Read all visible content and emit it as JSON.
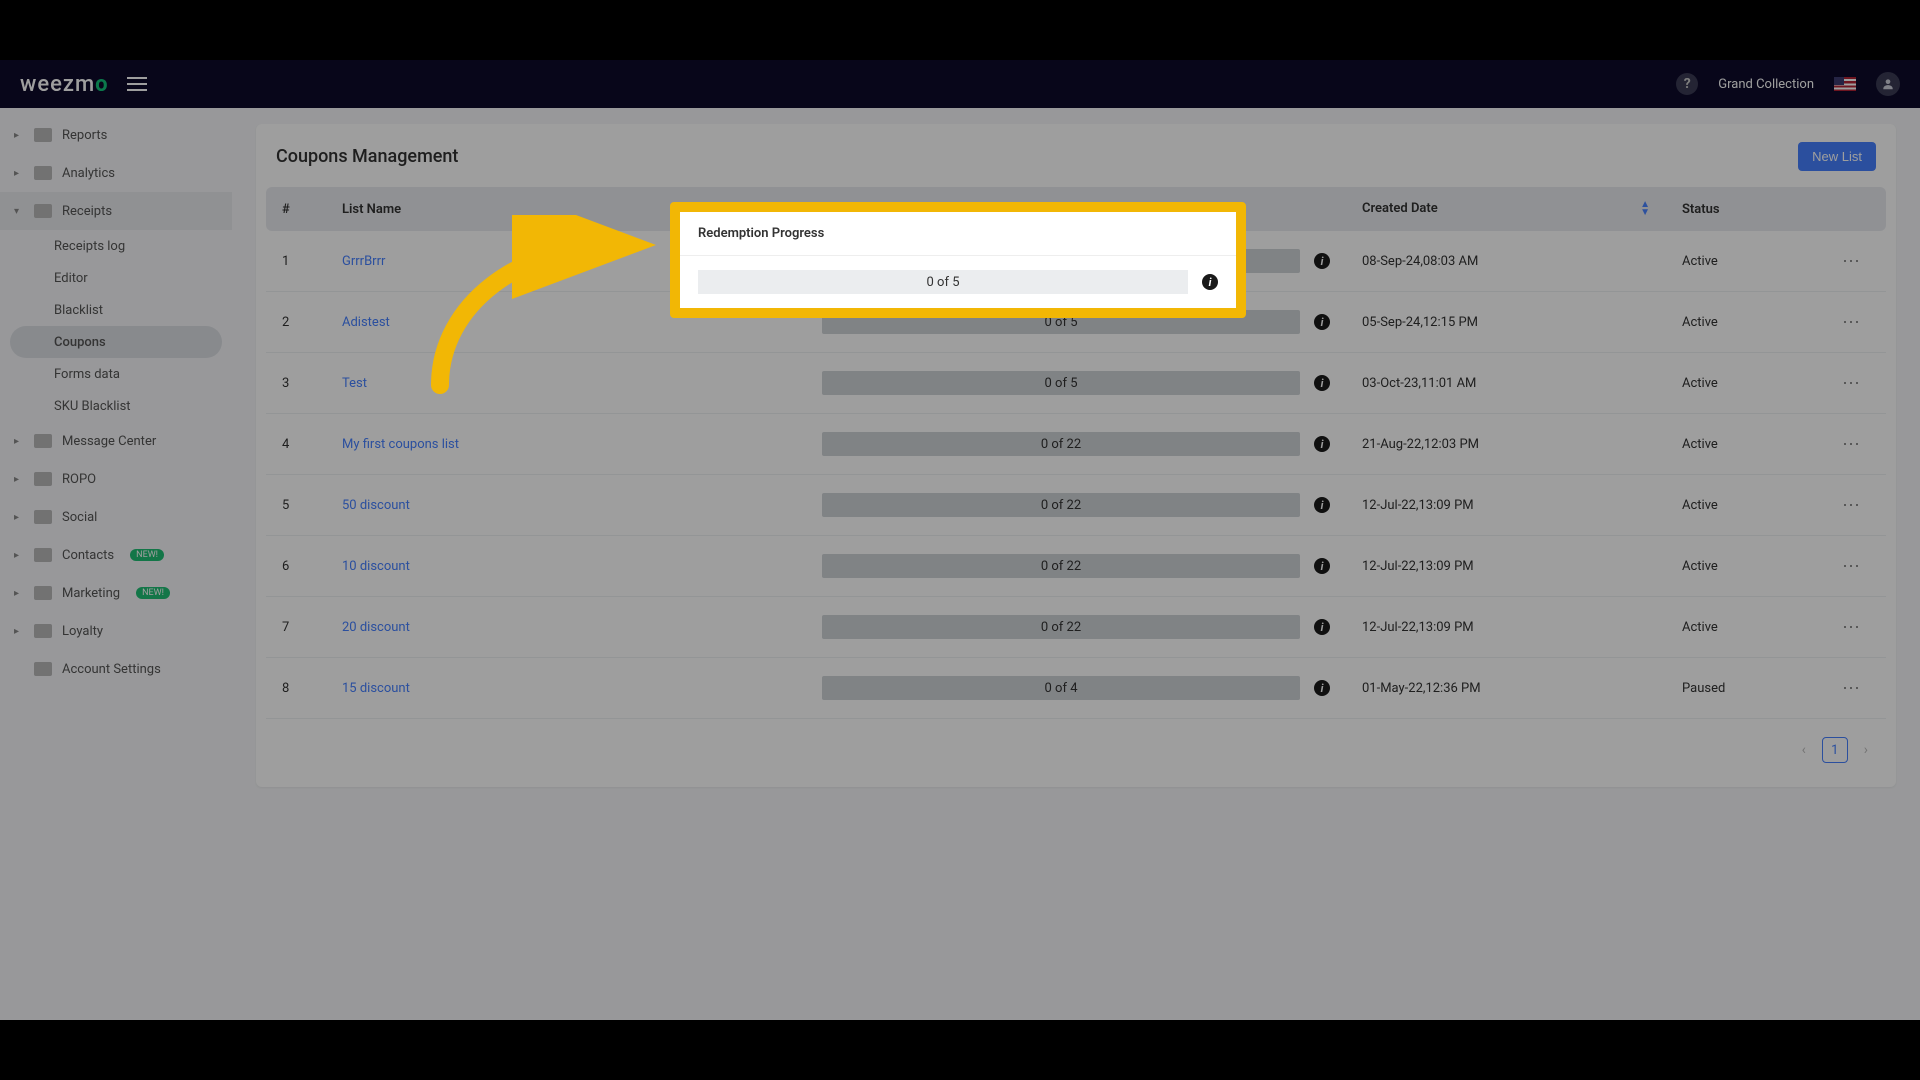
{
  "topbar": {
    "logo_main": "weezm",
    "logo_accent": "o",
    "account_name": "Grand Collection"
  },
  "sidebar": {
    "items": [
      {
        "label": "Reports"
      },
      {
        "label": "Analytics"
      },
      {
        "label": "Receipts",
        "expanded": true,
        "children": [
          {
            "label": "Receipts log"
          },
          {
            "label": "Editor"
          },
          {
            "label": "Blacklist"
          },
          {
            "label": "Coupons",
            "active": true
          },
          {
            "label": "Forms data"
          },
          {
            "label": "SKU Blacklist"
          }
        ]
      },
      {
        "label": "Message Center"
      },
      {
        "label": "ROPO"
      },
      {
        "label": "Social"
      },
      {
        "label": "Contacts",
        "badge": "NEW!"
      },
      {
        "label": "Marketing",
        "badge": "NEW!"
      },
      {
        "label": "Loyalty"
      },
      {
        "label": "Account Settings"
      }
    ]
  },
  "page": {
    "title": "Coupons Management",
    "new_list_label": "New List"
  },
  "table": {
    "columns": {
      "num": "#",
      "name": "List Name",
      "progress": "Redemption Progress",
      "date": "Created Date",
      "status": "Status"
    },
    "rows": [
      {
        "num": "1",
        "name": "GrrrBrrr",
        "progress": "0 of 5",
        "date": "08-Sep-24,08:03 AM",
        "status": "Active"
      },
      {
        "num": "2",
        "name": "Adistest",
        "progress": "0 of 5",
        "date": "05-Sep-24,12:15 PM",
        "status": "Active"
      },
      {
        "num": "3",
        "name": "Test",
        "progress": "0 of 5",
        "date": "03-Oct-23,11:01 AM",
        "status": "Active"
      },
      {
        "num": "4",
        "name": "My first coupons list",
        "progress": "0 of 22",
        "date": "21-Aug-22,12:03 PM",
        "status": "Active"
      },
      {
        "num": "5",
        "name": "50 discount",
        "progress": "0 of 22",
        "date": "12-Jul-22,13:09 PM",
        "status": "Active"
      },
      {
        "num": "6",
        "name": "10 discount",
        "progress": "0 of 22",
        "date": "12-Jul-22,13:09 PM",
        "status": "Active"
      },
      {
        "num": "7",
        "name": "20 discount",
        "progress": "0 of 22",
        "date": "12-Jul-22,13:09 PM",
        "status": "Active"
      },
      {
        "num": "8",
        "name": "15 discount",
        "progress": "0 of 4",
        "date": "01-May-22,12:36 PM",
        "status": "Paused"
      }
    ]
  },
  "pagination": {
    "current": "1"
  },
  "spotlight": {
    "header": "Redemption Progress",
    "value": "0 of 5"
  }
}
